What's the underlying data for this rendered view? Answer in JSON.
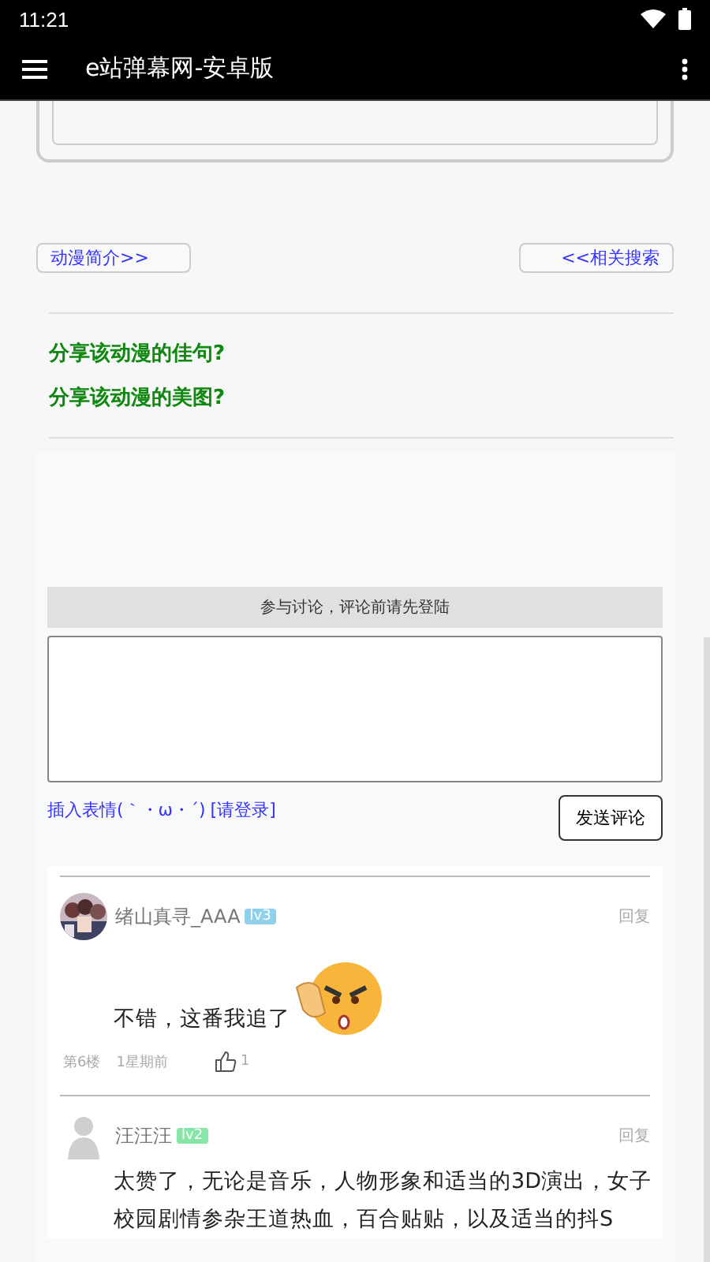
{
  "status_bar": {
    "time": "11:21"
  },
  "app_bar": {
    "title": "e站弹幕网-安卓版"
  },
  "nav_buttons": [
    {
      "label": "动漫简介>>"
    },
    {
      "label": "<<相关搜索"
    }
  ],
  "share_links": [
    "分享该动漫的佳句?",
    "分享该动漫的美图?"
  ],
  "comment_form": {
    "notice": "参与讨论，评论前请先登陆",
    "emoji_link": "插入表情(｀・ω・´)",
    "login_link": "[请登录]",
    "submit": "发送评论"
  },
  "comments": [
    {
      "user": "绪山真寻_AAA",
      "level_badge": "lv3",
      "color": "#8fd0ea",
      "reply": "回复",
      "text": "不错，这番我追了",
      "sticker": true,
      "floor": "第6楼",
      "time": "1星期前",
      "likes": "1"
    },
    {
      "user": "汪汪汪",
      "level_badge": "lv2",
      "color": "#86e6a8",
      "avatar": {
        "kind": "silhouette"
      },
      "reply": "回复",
      "text": "太赞了，无论是音乐，人物形象和适当的3D演出，女子校园剧情参杂王道热血，百合贴贴，以及适当的抖S",
      "sticker": false
    }
  ]
}
